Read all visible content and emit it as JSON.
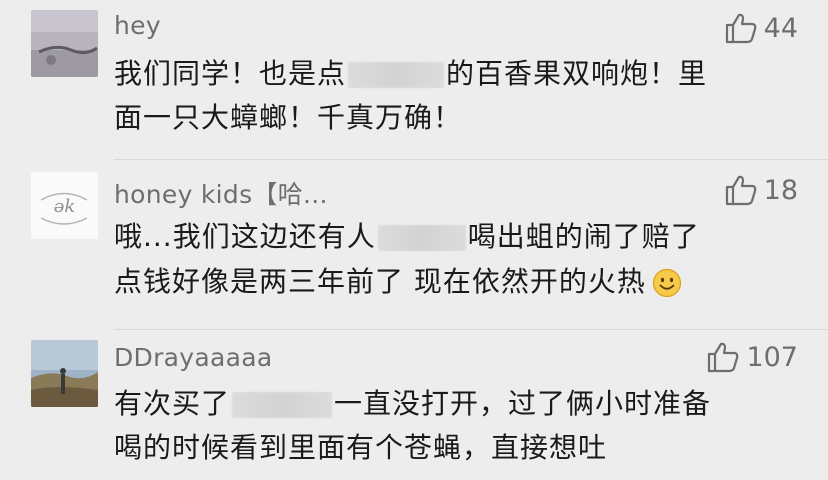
{
  "comments": [
    {
      "user": "hey",
      "likes": "44",
      "lines": [
        {
          "before": "我们同学！也是点",
          "after": "的百香果双响炮！里"
        },
        {
          "before": "面一只大蟑螂！千真万确！",
          "after": ""
        }
      ]
    },
    {
      "user": "honey kids【哈...",
      "likes": "18",
      "lines": [
        {
          "before": "哦...我们这边还有人",
          "after": "喝出蛆的闹了赔了"
        },
        {
          "before": "点钱好像是两三年前了 现在依然开的火热",
          "after": ""
        }
      ]
    },
    {
      "user": "DDrayaaaaa",
      "likes": "107",
      "lines": [
        {
          "before": "有次买了",
          "after": "一直没打开，过了俩小时准备"
        },
        {
          "before": "喝的时候看到里面有个苍蝇，直接想吐",
          "after": ""
        }
      ]
    }
  ],
  "icons": {
    "like": "thumbs-up-outline-icon",
    "emoji": "smile-emoji-icon"
  },
  "colors": {
    "background": "#ededed",
    "meta_text": "#6e6e6e",
    "body_text": "#1a1a1a"
  }
}
